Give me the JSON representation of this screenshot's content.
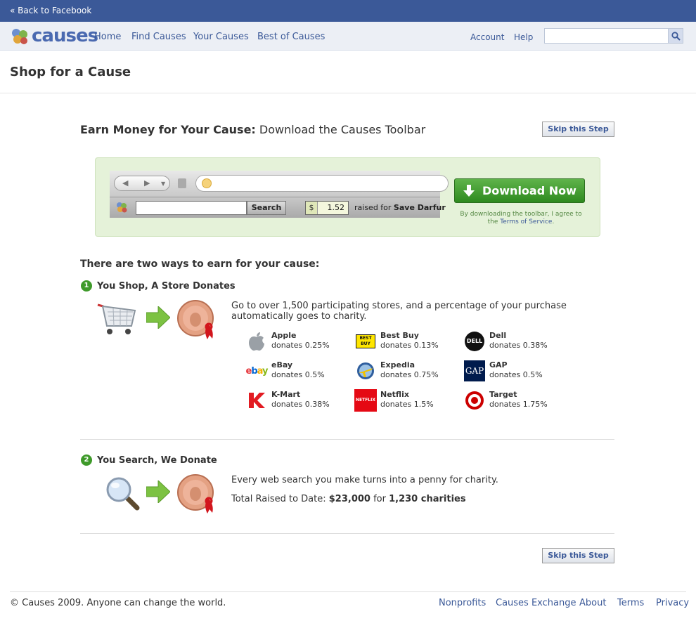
{
  "topbar": {
    "back_link": "« Back to Facebook"
  },
  "navbar": {
    "logo_text": "causes",
    "links": [
      "Home",
      "Find Causes",
      "Your Causes",
      "Best of Causes"
    ],
    "account": "Account",
    "help": "Help",
    "search_value": ""
  },
  "page": {
    "title": "Shop for a Cause"
  },
  "earn": {
    "heading_bold": "Earn Money for Your Cause:",
    "heading_rest": " Download the Causes Toolbar",
    "skip_label": "Skip this Step"
  },
  "toolbar_preview": {
    "search_button": "Search",
    "currency": "$",
    "amount": "1.52",
    "raised_prefix": "raised for ",
    "raised_cause": "Save Darfur"
  },
  "download": {
    "button_label": "Download Now",
    "note_prefix": "By downloading the toolbar, I agree to the ",
    "note_link": "Terms of Service",
    "note_suffix": "."
  },
  "ways": {
    "heading": "There are two ways to earn for your cause:",
    "step1": {
      "number": "1",
      "title": "You Shop, A Store Donates",
      "description": "Go to over 1,500 participating stores, and a percentage of your purchase automatically goes to charity.",
      "stores": [
        {
          "name": "Apple",
          "donation": "donates 0.25%"
        },
        {
          "name": "Best Buy",
          "donation": "donates 0.13%"
        },
        {
          "name": "Dell",
          "donation": "donates 0.38%"
        },
        {
          "name": "eBay",
          "donation": "donates 0.5%"
        },
        {
          "name": "Expedia",
          "donation": "donates 0.75%"
        },
        {
          "name": "GAP",
          "donation": "donates 0.5%"
        },
        {
          "name": "K-Mart",
          "donation": "donates 0.38%"
        },
        {
          "name": "Netflix",
          "donation": "donates 1.5%"
        },
        {
          "name": "Target",
          "donation": "donates 1.75%"
        }
      ]
    },
    "step2": {
      "number": "2",
      "title": "You Search, We Donate",
      "description": "Every web search you make turns into a penny for charity.",
      "total_prefix": "Total Raised to Date: ",
      "total_amount": "$23,000",
      "total_middle": " for ",
      "total_charities": "1,230 charities"
    }
  },
  "footer": {
    "copyright": "© Causes 2009. Anyone can change the world.",
    "links": [
      "Nonprofits",
      "Causes Exchange",
      "About",
      "Terms",
      "Privacy"
    ]
  },
  "icon_logos": {
    "bestbuy_text": "BEST BUY",
    "dell_text": "DELL",
    "gap_text": "GAP",
    "netflix_text": "NETFLIX",
    "ebay_letters": [
      "e",
      "b",
      "a",
      "y"
    ]
  }
}
